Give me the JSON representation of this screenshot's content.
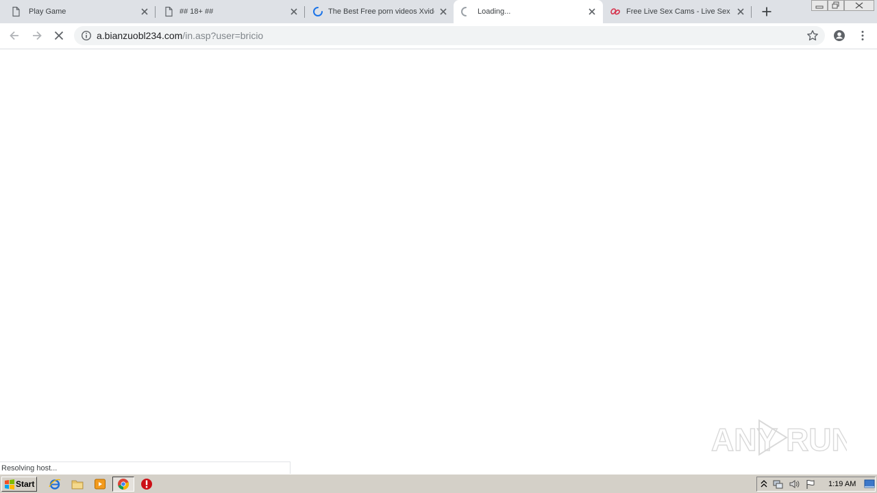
{
  "browser": {
    "tabs": [
      {
        "title": "Play Game",
        "icon": "page-icon",
        "active": false
      },
      {
        "title": "## 18+ ##",
        "icon": "page-icon",
        "active": false
      },
      {
        "title": "The Best Free porn videos Xvideos",
        "icon": "loading-spinner-icon",
        "active": false
      },
      {
        "title": "Loading...",
        "icon": "loading-spinner-icon",
        "active": true
      },
      {
        "title": "Free Live Sex Cams - Live Sex Chat",
        "icon": "site-favicon-icon",
        "active": false
      }
    ],
    "address": {
      "host": "a.bianzuobl234.com",
      "path": "/in.asp?user=bricio"
    },
    "status_text": "Resolving host..."
  },
  "watermark": {
    "text": "ANY RUN"
  },
  "taskbar": {
    "start_label": "Start",
    "clock": "1:19 AM"
  },
  "colors": {
    "tabstrip": "#dee1e6",
    "omnibox": "#f1f3f4",
    "spinner": "#1a73e8",
    "taskbar": "#d4d0c8"
  }
}
